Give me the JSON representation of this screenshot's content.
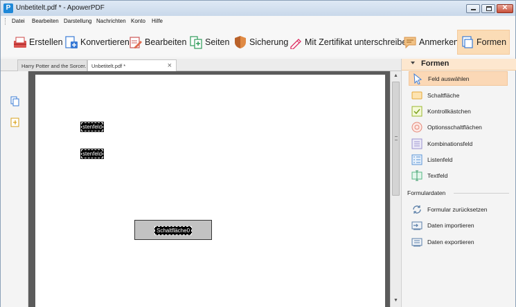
{
  "window": {
    "title": "Unbetitelt.pdf * - ApowerPDF",
    "app_icon_letter": "P",
    "close_glyph": "✕"
  },
  "menu": [
    "Datei",
    "Bearbeiten",
    "Darstellung",
    "Nachrichten",
    "Konto",
    "Hilfe"
  ],
  "toolbar": {
    "erstellen": "Erstellen",
    "konvertieren": "Konvertieren",
    "bearbeiten": "Bearbeiten",
    "seiten": "Seiten",
    "sicherung": "Sicherung",
    "zertifikat": "Mit Zertifikat unterschreiben",
    "anmerken": "Anmerken",
    "formen": "Formen"
  },
  "tabs": [
    {
      "label": "Harry Potter and the Sorcer..."
    },
    {
      "label": "Unbetitelt.pdf *",
      "close": "×"
    }
  ],
  "document": {
    "fields": [
      "stenfeld",
      "stenfeld"
    ],
    "button_field": "Schaltfläche0"
  },
  "scrollbar": {
    "up": "▲",
    "down": "▼"
  },
  "panel": {
    "title": "Formen",
    "items": [
      {
        "label": "Feld auswählen",
        "icon": "cursor-icon"
      },
      {
        "label": "Schaltfläche",
        "icon": "button-icon"
      },
      {
        "label": "Kontrollkästchen",
        "icon": "checkbox-icon"
      },
      {
        "label": "Optionsschaltflächen",
        "icon": "radio-icon"
      },
      {
        "label": "Kombinationsfeld",
        "icon": "combobox-icon"
      },
      {
        "label": "Listenfeld",
        "icon": "listbox-icon"
      },
      {
        "label": "Textfeld",
        "icon": "textfield-icon"
      }
    ],
    "section_title": "Formulardaten",
    "data_items": [
      {
        "label": "Formular zurücksetzen",
        "icon": "reset-icon"
      },
      {
        "label": "Daten importieren",
        "icon": "import-icon"
      },
      {
        "label": "Daten exportieren",
        "icon": "export-icon"
      }
    ]
  },
  "colors": {
    "accent": "#fbd8b6",
    "brand": "#1e88d8",
    "doc_bg": "#5b5b5b"
  }
}
